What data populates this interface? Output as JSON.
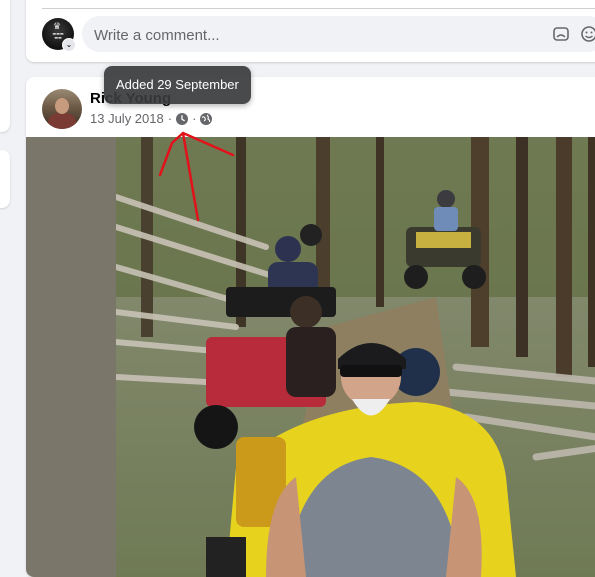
{
  "comment_box": {
    "placeholder": "Write a comment...",
    "avatar_icon": "keep-calm-avatar",
    "icons": [
      "gif-icon",
      "emoji-icon"
    ]
  },
  "post": {
    "author": "Rick Young",
    "date": "13 July 2018",
    "separator": "·",
    "icons": [
      "clock-icon",
      "globe-icon"
    ],
    "tooltip": "Added 29 September"
  },
  "colors": {
    "page_bg": "#f0f2f5",
    "card_bg": "#ffffff",
    "secondary_text": "#65676b",
    "tooltip_bg": "#3a3b3c",
    "annotation_red": "#e2121b"
  }
}
